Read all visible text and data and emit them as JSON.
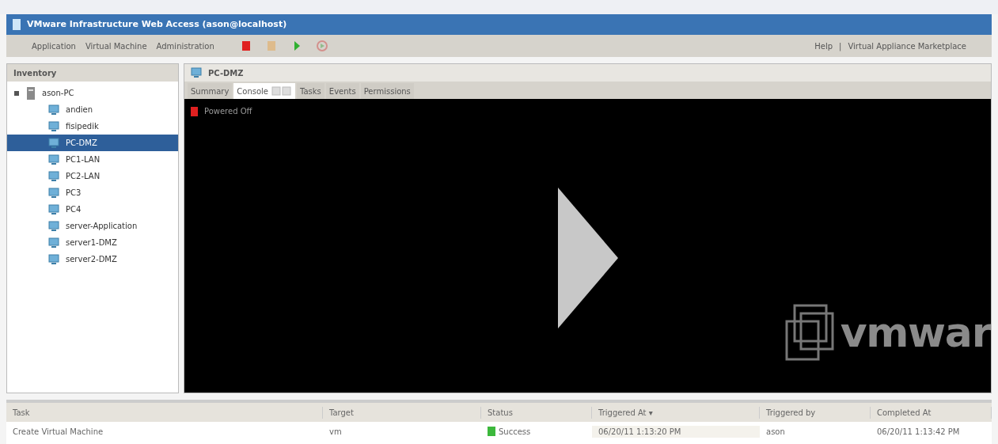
{
  "window": {
    "title": "VMware Infrastructure Web Access (ason@localhost)"
  },
  "menu": [
    "Application",
    "Virtual Machine",
    "Administration"
  ],
  "toolbar": [
    {
      "kind": "stop",
      "disabled": false
    },
    {
      "kind": "pause",
      "disabled": true
    },
    {
      "kind": "play",
      "disabled": false
    },
    {
      "kind": "reset",
      "disabled": true
    }
  ],
  "header_links": [
    "Help",
    "|",
    "Virtual Appliance Marketplace"
  ],
  "inventory": {
    "title": "Inventory",
    "tree": [
      {
        "label": "ason-PC",
        "kind": "host",
        "expanded": true,
        "selected": false,
        "children": [
          {
            "label": "andien",
            "kind": "vm",
            "selected": false
          },
          {
            "label": "fisipedik",
            "kind": "vm",
            "selected": false
          },
          {
            "label": "PC-DMZ",
            "kind": "vm",
            "selected": true
          },
          {
            "label": "PC1-LAN",
            "kind": "vm",
            "selected": false
          },
          {
            "label": "PC2-LAN",
            "kind": "vm",
            "selected": false
          },
          {
            "label": "PC3",
            "kind": "vm",
            "selected": false
          },
          {
            "label": "PC4",
            "kind": "vm",
            "selected": false
          },
          {
            "label": "server-Application",
            "kind": "vm",
            "selected": false
          },
          {
            "label": "server1-DMZ",
            "kind": "vm",
            "selected": false
          },
          {
            "label": "server2-DMZ",
            "kind": "vm",
            "selected": false
          }
        ]
      }
    ]
  },
  "vm_panel": {
    "title": "PC-DMZ",
    "tabs": [
      {
        "label": "Summary",
        "selected": false
      },
      {
        "label": "Console",
        "selected": true
      },
      {
        "label": "Tasks",
        "selected": false
      },
      {
        "label": "Events",
        "selected": false
      },
      {
        "label": "Permissions",
        "selected": false
      }
    ],
    "console": {
      "power_state": "Powered Off",
      "powered_on": false,
      "logo_text": "vmwar"
    }
  },
  "tasks": {
    "columns": [
      "Task",
      "Target",
      "Status",
      "Triggered At ▾",
      "Triggered by",
      "Completed At"
    ],
    "rows": [
      {
        "cells": [
          "Create Virtual Machine",
          "vm",
          "Success",
          "06/20/11 1:13:20 PM",
          "ason",
          "06/20/11 1:13:42 PM"
        ],
        "color": "#3cb83c"
      }
    ]
  }
}
